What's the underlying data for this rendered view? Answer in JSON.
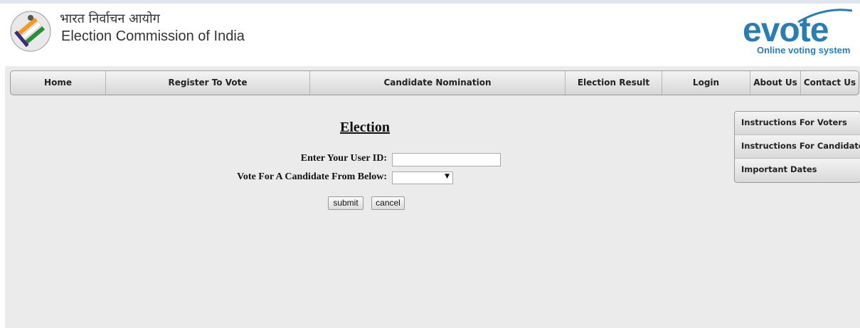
{
  "header": {
    "hindi_title": "भारत निर्वाचन आयोग",
    "english_title": "Election Commission of India",
    "evote_logo_text": "evote",
    "evote_tagline": "Online voting system"
  },
  "nav": {
    "items": [
      {
        "label": "Home"
      },
      {
        "label": "Register To Vote"
      },
      {
        "label": "Candidate Nomination"
      },
      {
        "label": "Election Result"
      },
      {
        "label": "Login"
      },
      {
        "label": "About Us"
      },
      {
        "label": "Contact Us"
      }
    ]
  },
  "form": {
    "title": "Election",
    "userid_label": "Enter Your User ID:",
    "userid_value": "",
    "candidate_label": "Vote For A Candidate From Below:",
    "candidate_selected": "",
    "submit_label": "submit",
    "cancel_label": "cancel"
  },
  "side_menu": {
    "items": [
      {
        "label": "Instructions For Voters"
      },
      {
        "label": "Instructions For Candidates"
      },
      {
        "label": "Important Dates"
      }
    ]
  },
  "colors": {
    "brand_blue": "#2a7db3",
    "content_bg": "#ebebeb"
  },
  "icons": {
    "eci_logo": "ballot-finger-logo",
    "select_arrow": "dropdown-arrow-icon"
  }
}
